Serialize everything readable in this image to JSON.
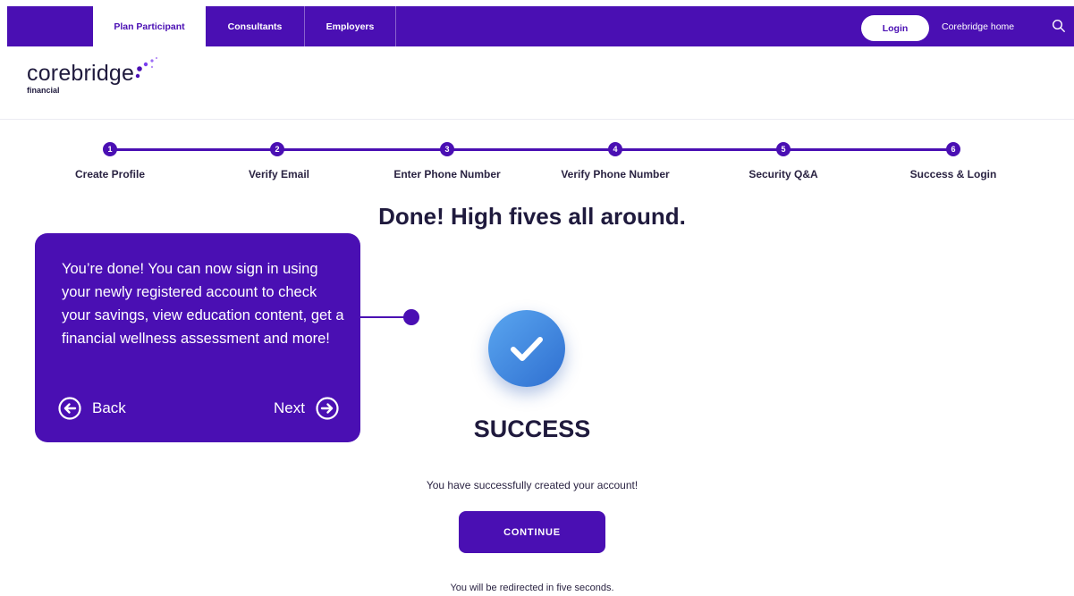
{
  "nav": {
    "tabs": [
      {
        "label": "Plan Participant",
        "active": true
      },
      {
        "label": "Consultants",
        "active": false
      },
      {
        "label": "Employers",
        "active": false
      }
    ],
    "login_label": "Login",
    "home_link": "Corebridge home",
    "search_icon": "search-icon"
  },
  "brand": {
    "name": "corebridge",
    "sub": "financial"
  },
  "stepper": {
    "steps": [
      {
        "number": "1",
        "label": "Create Profile"
      },
      {
        "number": "2",
        "label": "Verify Email"
      },
      {
        "number": "3",
        "label": "Enter Phone Number"
      },
      {
        "number": "4",
        "label": "Verify Phone Number"
      },
      {
        "number": "5",
        "label": "Security Q&A"
      },
      {
        "number": "6",
        "label": "Success & Login"
      }
    ],
    "current_step": 6
  },
  "main": {
    "headline": "Done! High fives all around.",
    "status_icon": "checkmark-icon",
    "success_title": "SUCCESS",
    "success_message": "You have successfully created your account!",
    "continue_label": "CONTINUE",
    "redirect_message": "You will be redirected in five seconds."
  },
  "callout": {
    "text": "You’re done! You can now sign in using your newly registered account to check your savings, view education content, get a financial wellness assessment and more!",
    "back_label": "Back",
    "next_label": "Next"
  },
  "colors": {
    "brand_purple": "#4a0fb3",
    "success_blue": "#3b82e0",
    "text_dark": "#1f1a3d"
  }
}
